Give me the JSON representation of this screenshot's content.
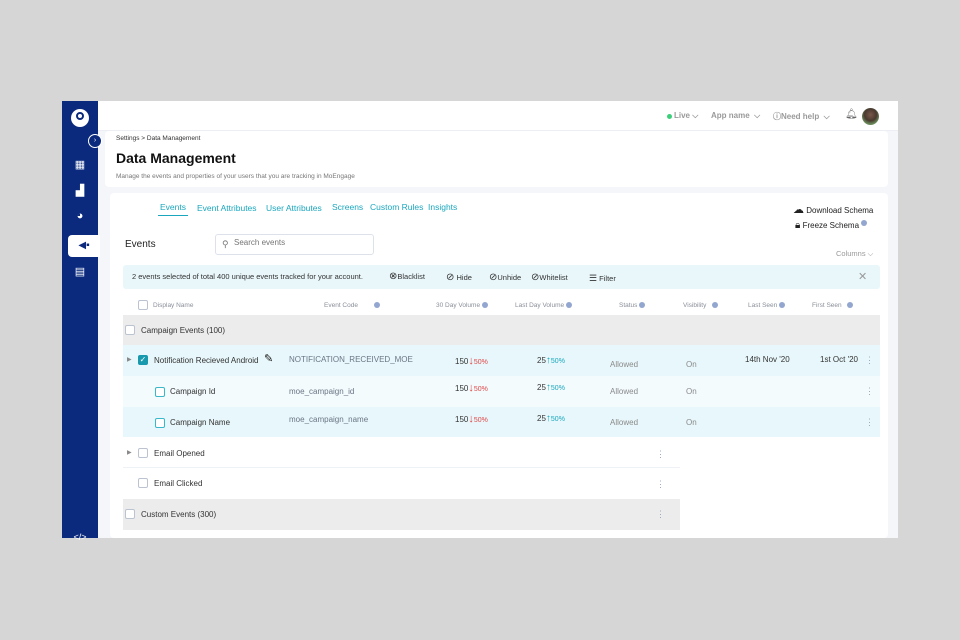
{
  "topbar": {
    "live": "Live",
    "app_name": "App name",
    "help": "Need help"
  },
  "header": {
    "breadcrumb": "Settings > Data Management",
    "title": "Data Management",
    "subtitle": "Manage the events and properties of your users that you are tracking in MoEngage"
  },
  "tabs": [
    "Events",
    "Event Attributes",
    "User Attributes",
    "Screens",
    "Custom Rules",
    "Insights"
  ],
  "actions": {
    "download": "Download Schema",
    "freeze": "Freeze Schema",
    "columns": "Columns"
  },
  "events_title": "Events",
  "search": {
    "placeholder": "Search events"
  },
  "selection_bar": {
    "text": "2 events selected of total 400 unique events tracked for your account.",
    "blacklist": "Blacklist",
    "hide": "Hide",
    "unhide": "Unhide",
    "whitelist": "Whitelist",
    "filter": "Filter"
  },
  "columns": [
    "Display Name",
    "Event Code",
    "30 Day Volume",
    "Last Day Volume",
    "Status",
    "Visibility",
    "Last Seen",
    "First Seen"
  ],
  "groups": {
    "campaign": "Campaign Events (100)",
    "custom": "Custom Events (300)"
  },
  "rows": [
    {
      "name": "Notification Recieved Android",
      "code": "NOTIFICATION_RECEIVED_MOE",
      "vol30": "150",
      "vol30_change": "50%",
      "vol1": "25",
      "vol1_change": "50%",
      "status": "Allowed",
      "visibility": "On",
      "last_seen": "14th Nov '20",
      "first_seen": "1st Oct '20"
    },
    {
      "name": "Campaign Id",
      "code": "moe_campaign_id",
      "vol30": "150",
      "vol30_change": "50%",
      "vol1": "25",
      "vol1_change": "50%",
      "status": "Allowed",
      "visibility": "On"
    },
    {
      "name": "Campaign Name",
      "code": "moe_campaign_name",
      "vol30": "150",
      "vol30_change": "50%",
      "vol1": "25",
      "vol1_change": "50%",
      "status": "Allowed",
      "visibility": "On"
    },
    {
      "name": "Email Opened"
    },
    {
      "name": "Email Clicked"
    }
  ],
  "colors": {
    "sidebar": "#0b2a7e",
    "accent": "#1aa7be",
    "down": "#e04848",
    "live": "#3ccf7a"
  }
}
